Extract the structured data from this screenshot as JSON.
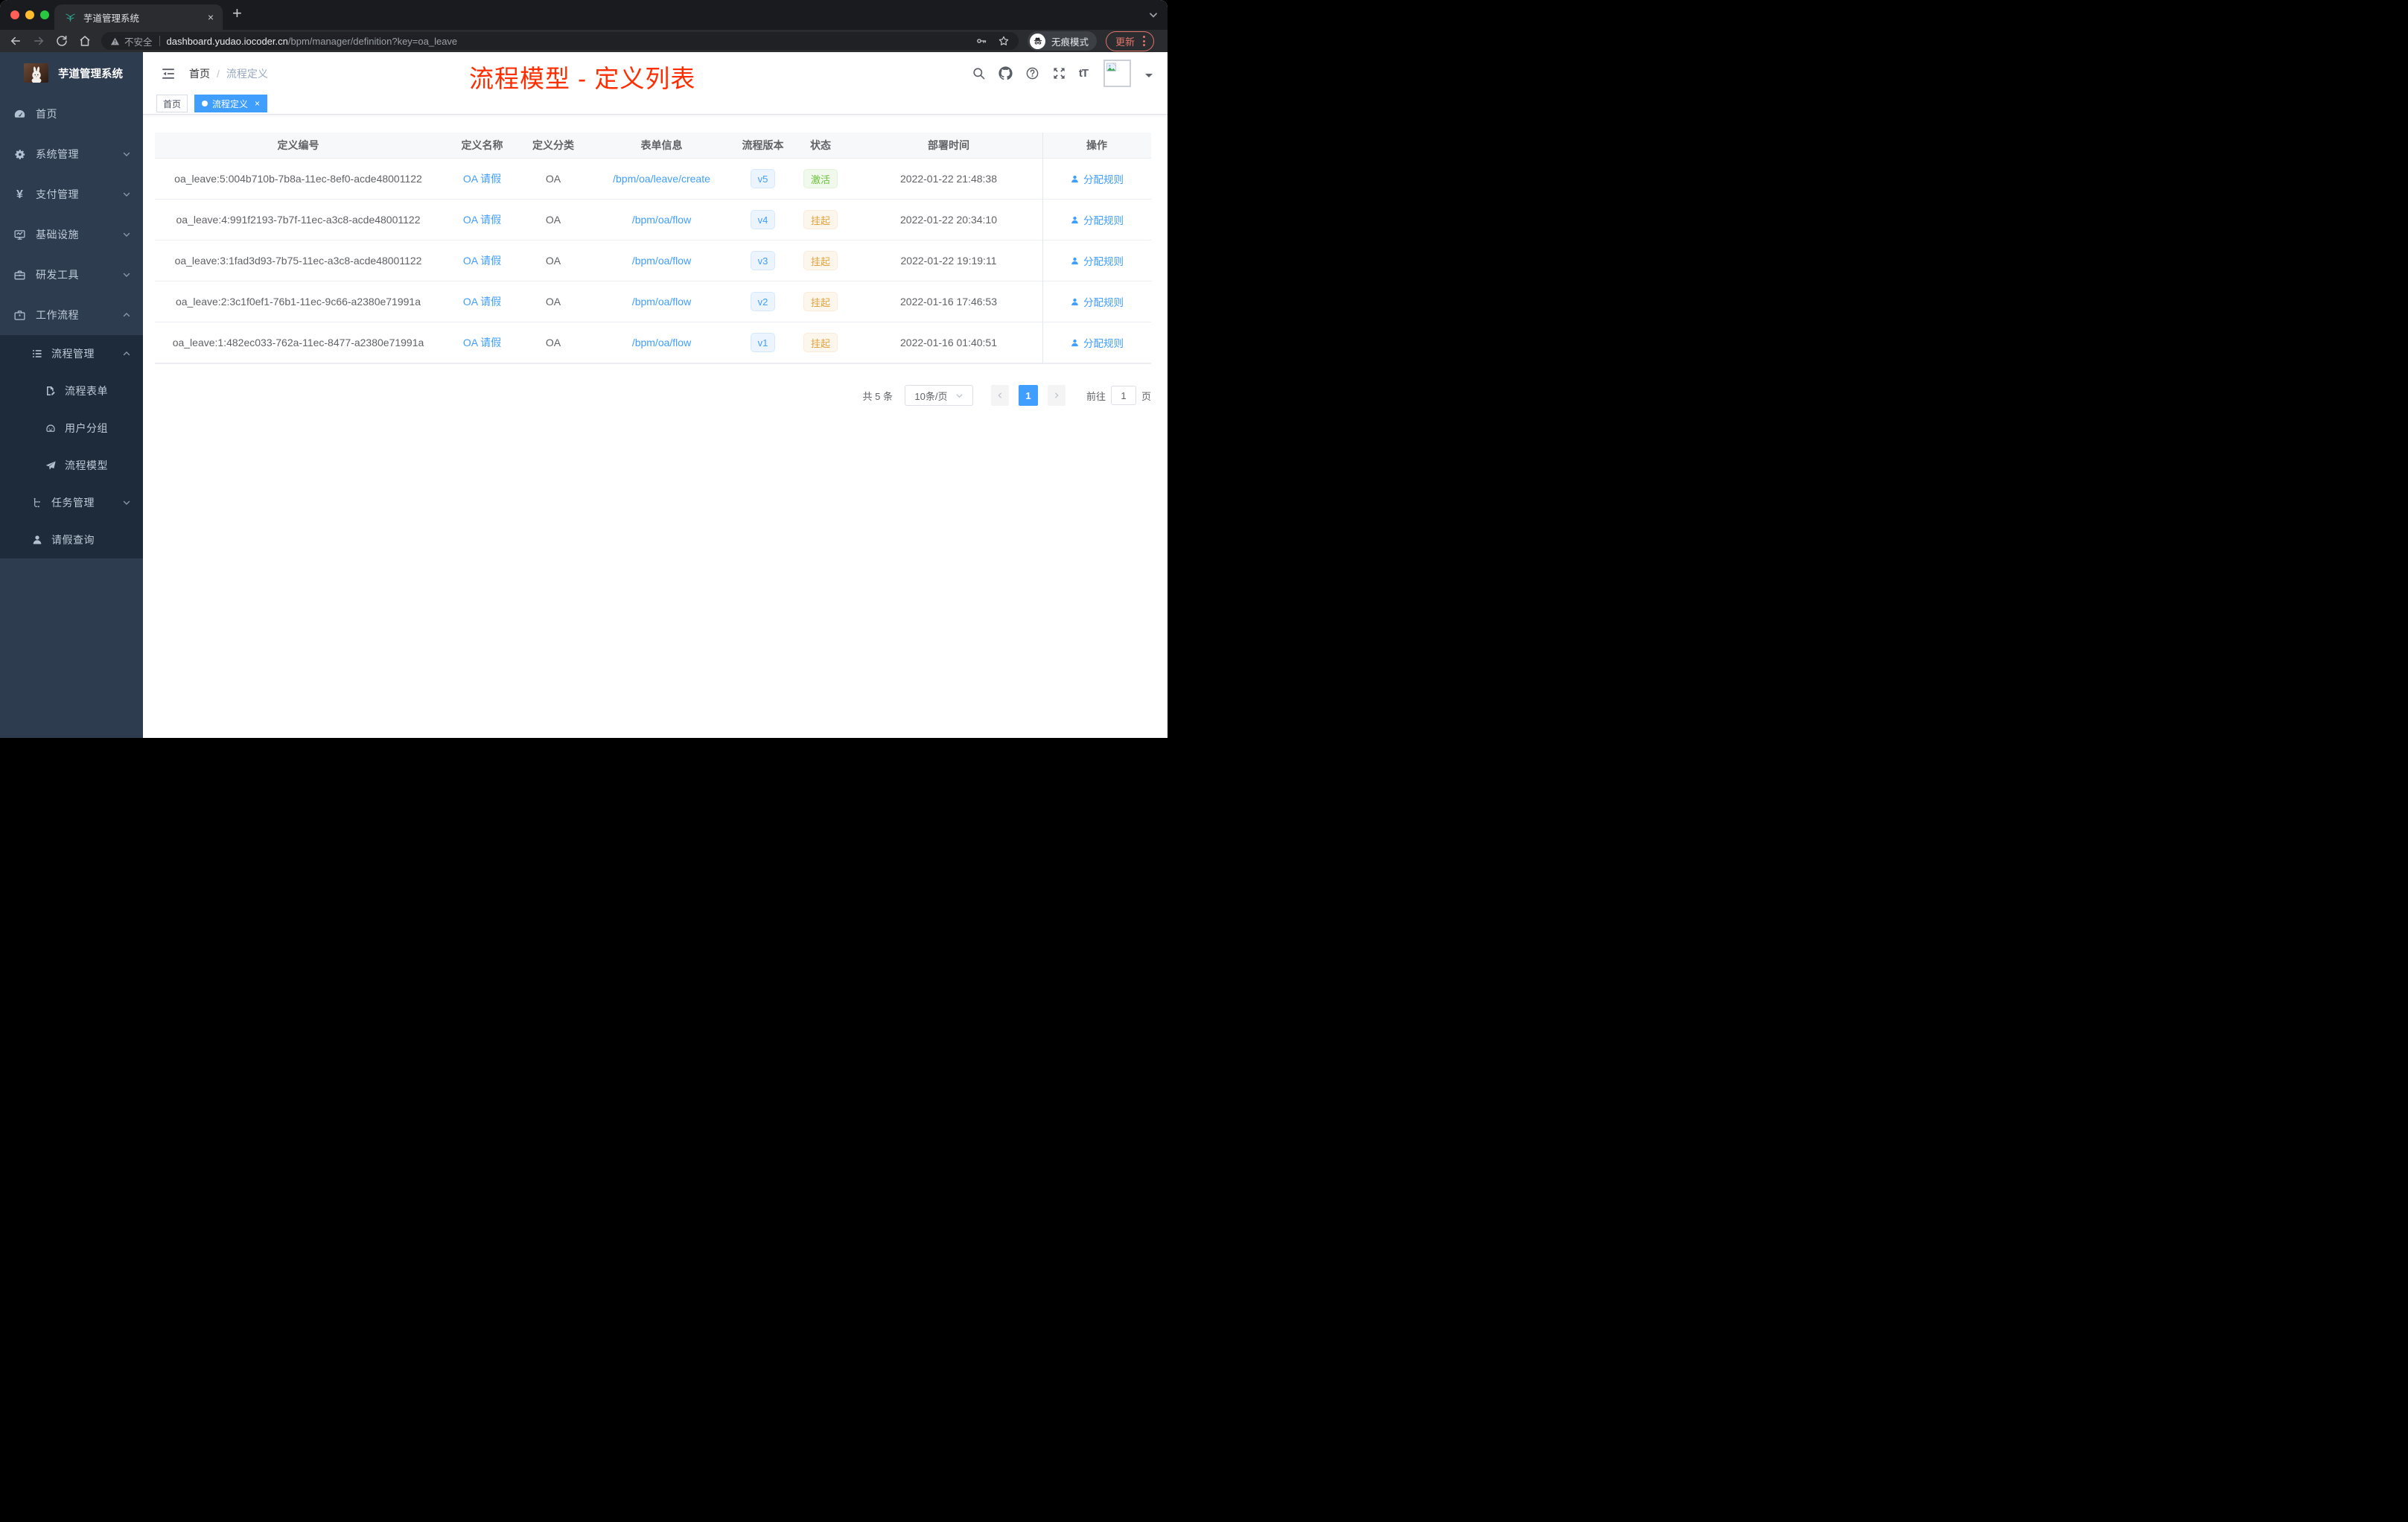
{
  "browser": {
    "tab_title": "芋道管理系统",
    "new_tab_glyph": "+",
    "close_glyph": "×",
    "security_label": "不安全",
    "url_host": "dashboard.yudao.iocoder.cn",
    "url_path": "/bpm/manager/definition?key=oa_leave",
    "incognito_label": "无痕模式",
    "update_label": "更新"
  },
  "sidebar": {
    "brand": "芋道管理系统",
    "items": [
      {
        "label": "首页",
        "icon": "dashboard-icon",
        "expandable": false
      },
      {
        "label": "系统管理",
        "icon": "gear-icon",
        "expandable": true,
        "expanded": false
      },
      {
        "label": "支付管理",
        "icon": "yen-icon",
        "expandable": true,
        "expanded": false
      },
      {
        "label": "基础设施",
        "icon": "monitor-icon",
        "expandable": true,
        "expanded": false
      },
      {
        "label": "研发工具",
        "icon": "toolbox-icon",
        "expandable": true,
        "expanded": false
      },
      {
        "label": "工作流程",
        "icon": "briefcase-icon",
        "expandable": true,
        "expanded": true
      }
    ],
    "workflow_children": [
      {
        "label": "流程管理",
        "icon": "list-icon",
        "level": 2,
        "expandable": true,
        "expanded": true
      },
      {
        "label": "流程表单",
        "icon": "form-icon",
        "level": 3
      },
      {
        "label": "用户分组",
        "icon": "robot-icon",
        "level": 3
      },
      {
        "label": "流程模型",
        "icon": "plane-icon",
        "level": 3
      },
      {
        "label": "任务管理",
        "icon": "tree-icon",
        "level": 2,
        "expandable": true,
        "expanded": false
      },
      {
        "label": "请假查询",
        "icon": "user-icon",
        "level": 2
      }
    ]
  },
  "header": {
    "breadcrumb_root": "首页",
    "breadcrumb_sep": "/",
    "breadcrumb_current": "流程定义",
    "annotation": "流程模型 - 定义列表"
  },
  "tags": {
    "home": {
      "label": "首页",
      "active": false
    },
    "current": {
      "label": "流程定义",
      "active": true,
      "close_glyph": "×"
    }
  },
  "table": {
    "columns": [
      "定义编号",
      "定义名称",
      "定义分类",
      "表单信息",
      "流程版本",
      "状态",
      "部署时间",
      "操作"
    ],
    "action_label": "分配规则",
    "rows": [
      {
        "id": "oa_leave:5:004b710b-7b8a-11ec-8ef0-acde48001122",
        "name": "OA 请假",
        "category": "OA",
        "form": "/bpm/oa/leave/create",
        "version": "v5",
        "status": "激活",
        "status_type": "success",
        "deployed": "2022-01-22 21:48:38"
      },
      {
        "id": "oa_leave:4:991f2193-7b7f-11ec-a3c8-acde48001122",
        "name": "OA 请假",
        "category": "OA",
        "form": "/bpm/oa/flow",
        "version": "v4",
        "status": "挂起",
        "status_type": "warning",
        "deployed": "2022-01-22 20:34:10"
      },
      {
        "id": "oa_leave:3:1fad3d93-7b75-11ec-a3c8-acde48001122",
        "name": "OA 请假",
        "category": "OA",
        "form": "/bpm/oa/flow",
        "version": "v3",
        "status": "挂起",
        "status_type": "warning",
        "deployed": "2022-01-22 19:19:11"
      },
      {
        "id": "oa_leave:2:3c1f0ef1-76b1-11ec-9c66-a2380e71991a",
        "name": "OA 请假",
        "category": "OA",
        "form": "/bpm/oa/flow",
        "version": "v2",
        "status": "挂起",
        "status_type": "warning",
        "deployed": "2022-01-16 17:46:53"
      },
      {
        "id": "oa_leave:1:482ec033-762a-11ec-8477-a2380e71991a",
        "name": "OA 请假",
        "category": "OA",
        "form": "/bpm/oa/flow",
        "version": "v1",
        "status": "挂起",
        "status_type": "warning",
        "deployed": "2022-01-16 01:40:51"
      }
    ]
  },
  "pagination": {
    "total": "共 5 条",
    "page_size": "10条/页",
    "current_page": "1",
    "goto_label": "前往",
    "page_unit": "页"
  },
  "colors": {
    "accent": "#409eff",
    "annotation_red": "#ff2d00",
    "success": "#67c23a",
    "warning": "#e6a23c",
    "sidebar_bg": "#2e3c50",
    "submenu_bg": "#1d2b3a"
  }
}
